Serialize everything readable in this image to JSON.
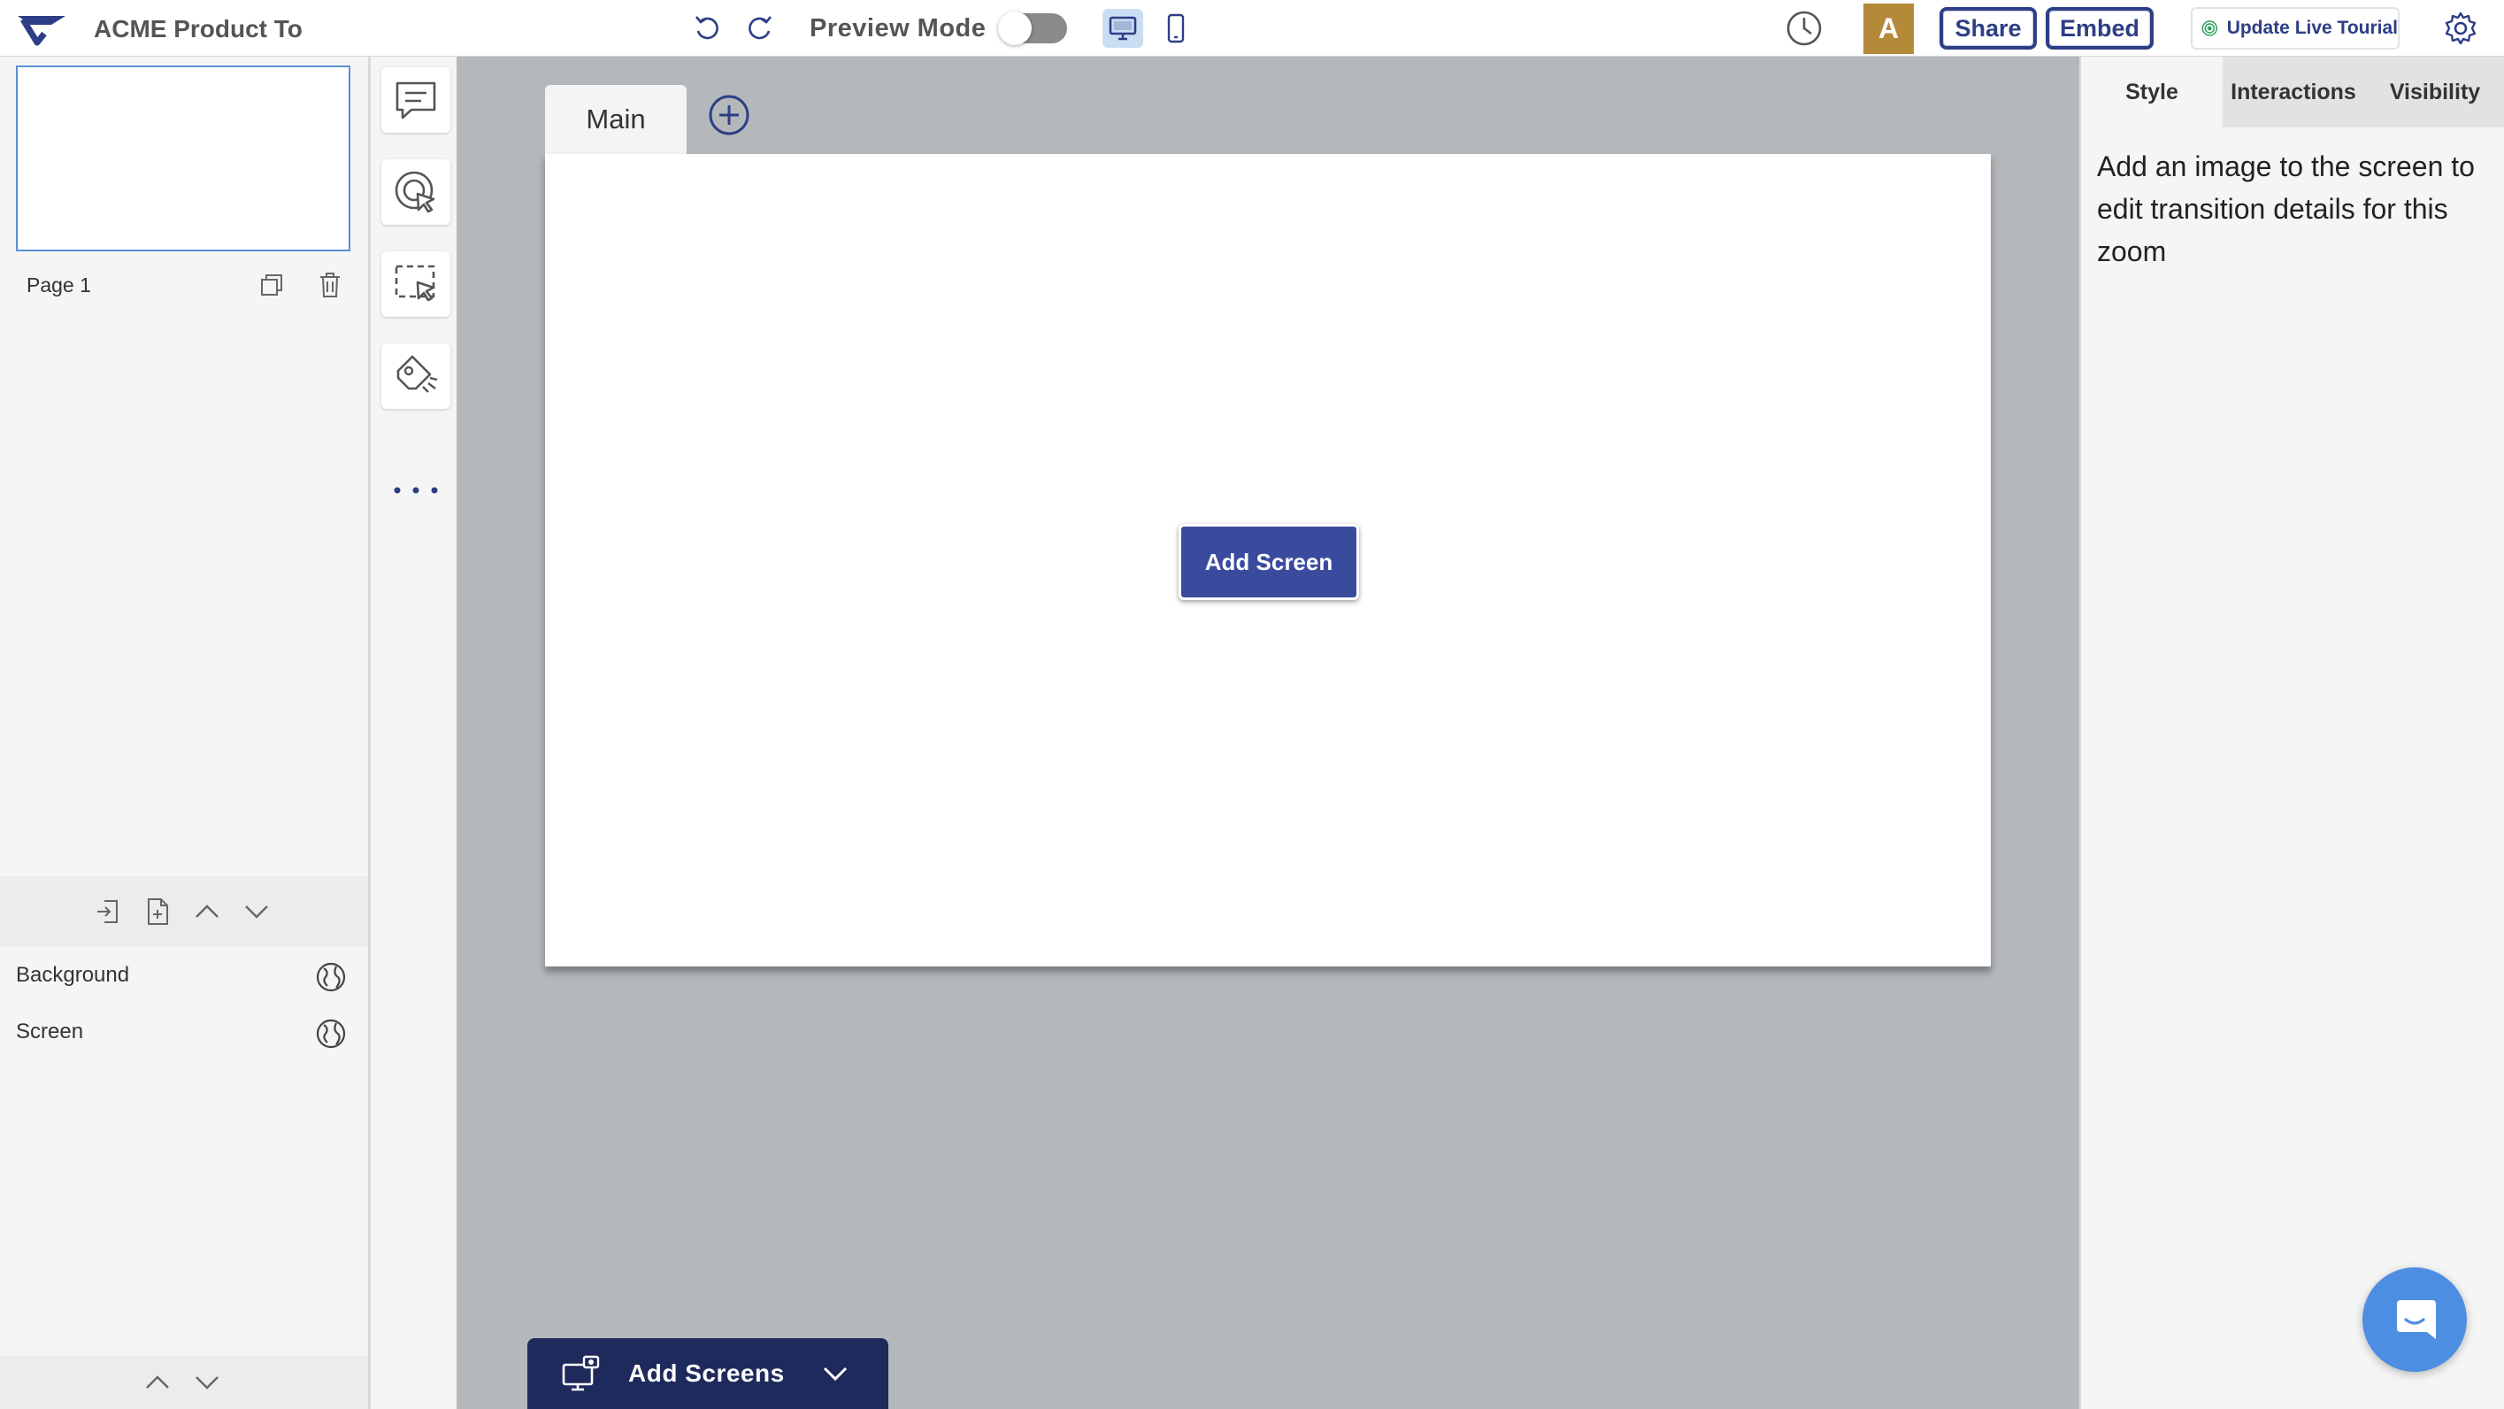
{
  "header": {
    "app_title": "ACME Product To",
    "preview_mode_label": "Preview Mode",
    "preview_mode_on": false,
    "avatar_initial": "A",
    "share_label": "Share",
    "embed_label": "Embed",
    "update_live_label": "Update Live Tourial",
    "icons": [
      "logo-icon",
      "undo-icon",
      "redo-icon",
      "desktop-icon",
      "mobile-icon",
      "history-icon",
      "gear-icon"
    ]
  },
  "left_panel": {
    "pages": [
      {
        "label": "Page 1"
      }
    ],
    "layers": [
      {
        "label": "Background",
        "icon": "globe-icon"
      },
      {
        "label": "Screen",
        "icon": "globe-icon"
      }
    ]
  },
  "tool_rail": {
    "tools": [
      "comment-icon",
      "hotspot-icon",
      "select-area-icon",
      "paint-icon",
      "more-icon"
    ]
  },
  "canvas": {
    "tabs": [
      {
        "label": "Main"
      }
    ],
    "add_screen_label": "Add Screen",
    "add_screens_label": "Add Screens"
  },
  "right_panel": {
    "tabs": [
      {
        "label": "Style",
        "active": true
      },
      {
        "label": "Interactions",
        "active": false
      },
      {
        "label": "Visibility",
        "active": false
      }
    ],
    "message": "Add an image to the screen to edit transition details for this zoom"
  },
  "colors": {
    "brand": "#2e3e86",
    "primary_button": "#3a4b9e",
    "bottom_bar": "#1f2a5c",
    "avatar": "#b5893a",
    "chat": "#4e8ee2",
    "canvas_bg": "#b4b8bb"
  }
}
